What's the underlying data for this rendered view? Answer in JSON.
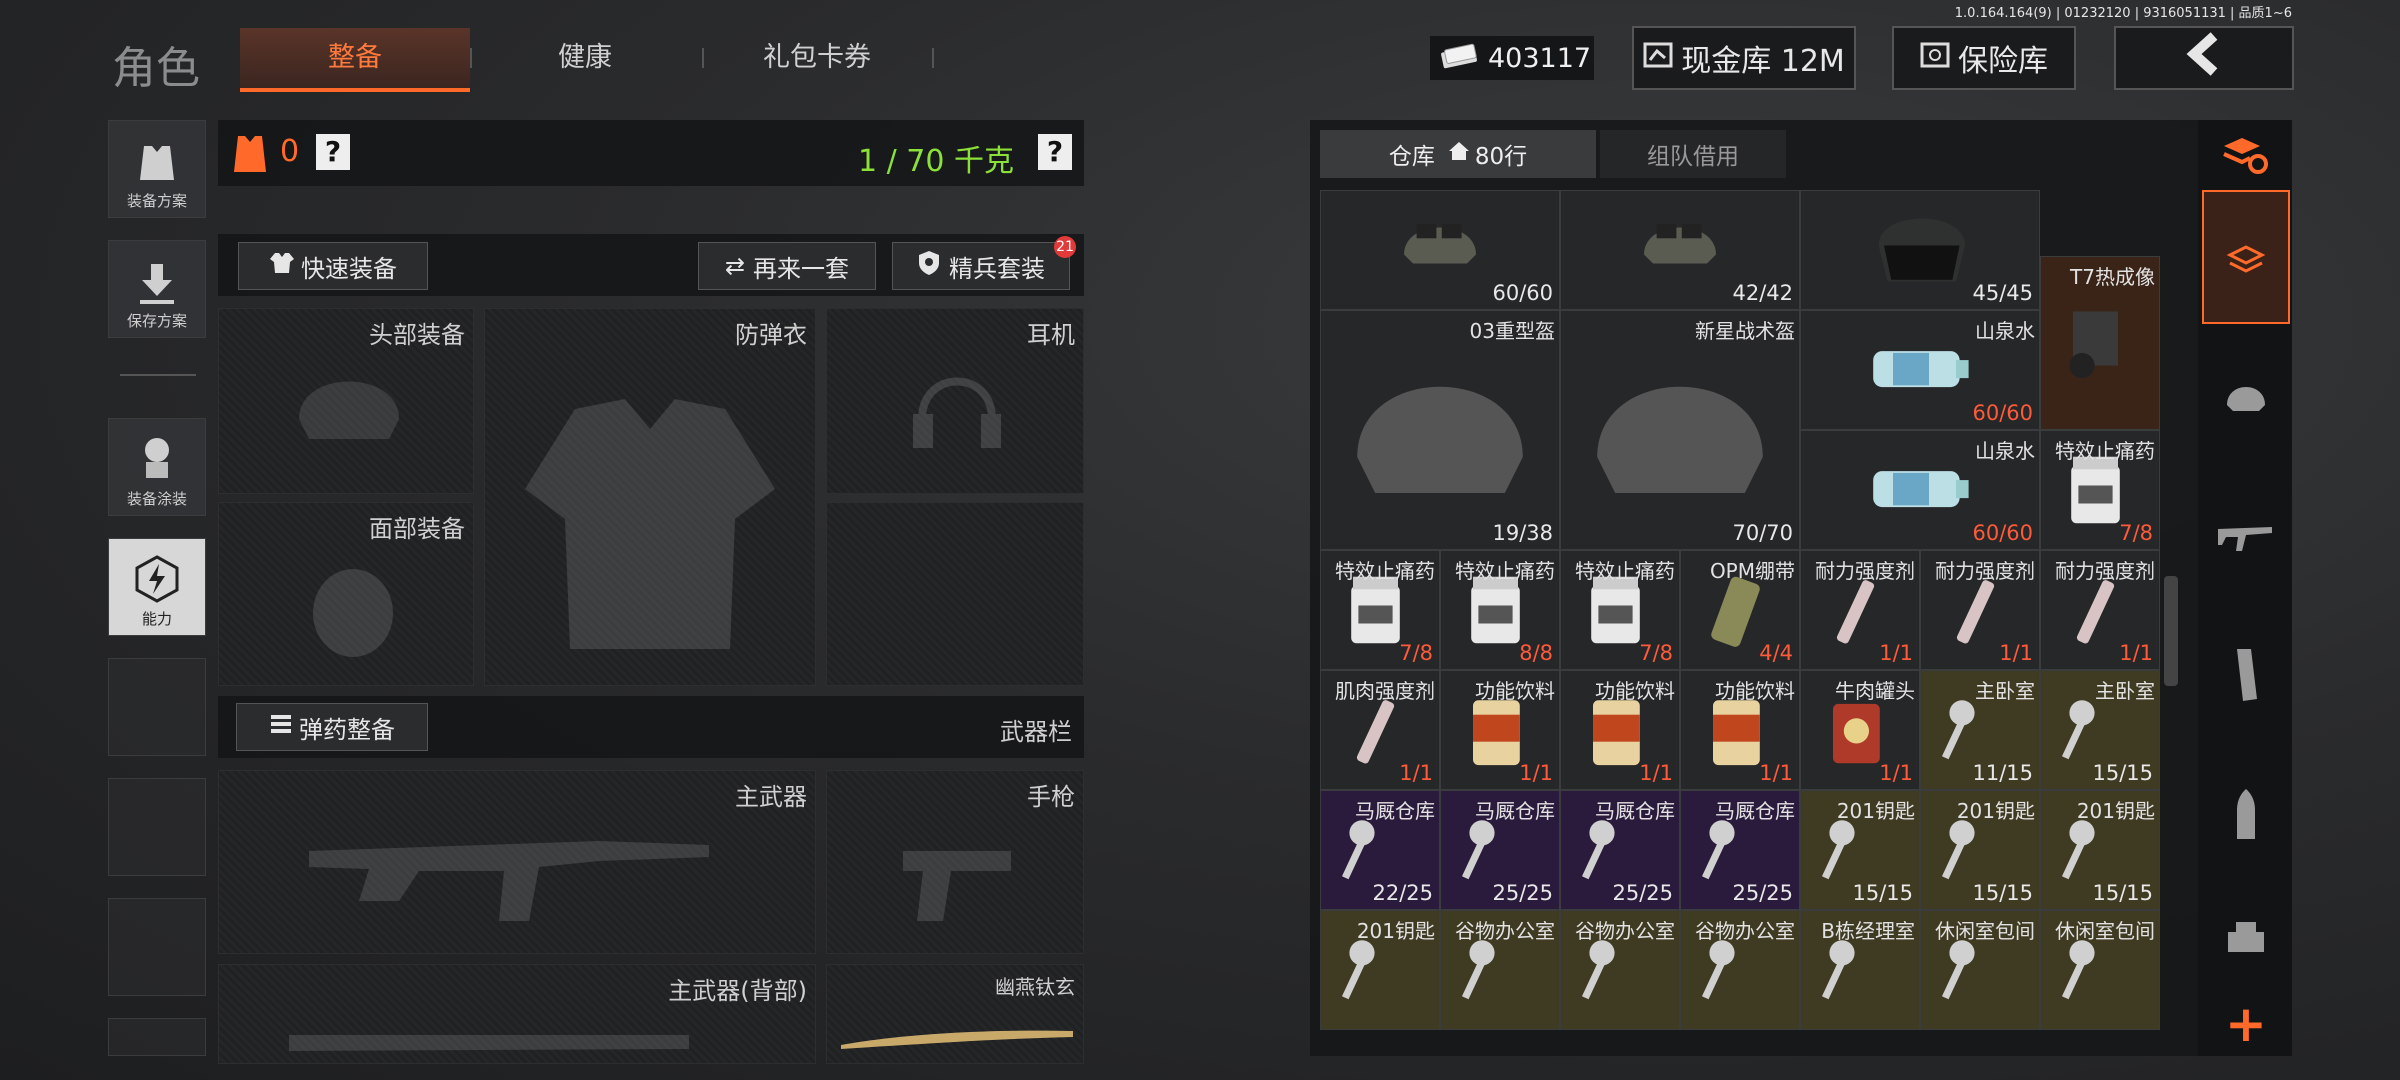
{
  "version": "1.0.164.164(9) | 01232120 | 9316051131 | 品质1~6",
  "header": {
    "title": "角色",
    "tabs": [
      {
        "label": "整备",
        "active": true
      },
      {
        "label": "健康",
        "active": false
      },
      {
        "label": "礼包卡券",
        "active": false
      }
    ],
    "currency": "403117",
    "cash_store": "现金库 12M",
    "safe": "保险库"
  },
  "sidebar": {
    "items": [
      {
        "label": "装备方案",
        "icon": "vest-plan-icon"
      },
      {
        "label": "保存方案",
        "icon": "download-icon"
      },
      {
        "label": "装备涂装",
        "icon": "paint-icon"
      },
      {
        "label": "能力",
        "icon": "ability-icon"
      }
    ]
  },
  "loadout": {
    "armor_value": "0",
    "help_1": "?",
    "weight": "1 / 70 千克",
    "help_2": "?",
    "quick_equip": "快速装备",
    "again": "再来一套",
    "elite_kit": "精兵套装",
    "elite_badge": "21",
    "slots": {
      "head": "头部装备",
      "vest": "防弹衣",
      "headset": "耳机",
      "face": "面部装备"
    },
    "ammo_equip": "弹药整备",
    "weapon_bar": "武器栏",
    "weapons": {
      "primary": "主武器",
      "pistol": "手枪",
      "primary_back": "主武器(背部)",
      "melee": "幽燕钛玄"
    }
  },
  "warehouse": {
    "tab_store": "仓库",
    "rows": "80行",
    "tab_team": "组队借用",
    "items": [
      {
        "name": "",
        "count": "60/60",
        "type": "nvg-helmet-icon",
        "col": 0,
        "row": 0,
        "w": 1,
        "h": 1
      },
      {
        "name": "",
        "count": "42/42",
        "type": "nvg-helmet-icon",
        "col": 1,
        "row": 0,
        "w": 1,
        "h": 1
      },
      {
        "name": "",
        "count": "45/45",
        "type": "faceshield-helmet-icon",
        "col": 2,
        "row": 0,
        "w": 1,
        "h": 1
      },
      {
        "name": "T7热成像",
        "count": "",
        "type": "thermal-scope-icon",
        "col": 3,
        "row": 0.55,
        "w": 0.5,
        "h": 1.45,
        "bg": "brown"
      },
      {
        "name": "03重型盔",
        "count": "19/38",
        "type": "helmet-icon",
        "col": 0,
        "row": 1,
        "w": 1,
        "h": 2
      },
      {
        "name": "新星战术盔",
        "count": "70/70",
        "type": "helmet-icon",
        "col": 1,
        "row": 1,
        "w": 1,
        "h": 2
      },
      {
        "name": "山泉水",
        "count": "60/60",
        "red": true,
        "type": "water-bottle-icon",
        "col": 2,
        "row": 1,
        "w": 1,
        "h": 1
      },
      {
        "name": "山泉水",
        "count": "60/60",
        "red": true,
        "type": "water-bottle-icon",
        "col": 2,
        "row": 2,
        "w": 1,
        "h": 1
      },
      {
        "name": "特效止痛药",
        "count": "7/8",
        "red": true,
        "type": "pill-bottle-icon",
        "col": 3,
        "row": 2,
        "w": 0.5,
        "h": 1
      },
      {
        "name": "特效止痛药",
        "count": "7/8",
        "red": true,
        "type": "pill-bottle-icon",
        "sc": 0,
        "row": 3
      },
      {
        "name": "特效止痛药",
        "count": "8/8",
        "red": true,
        "type": "pill-bottle-icon",
        "sc": 1,
        "row": 3
      },
      {
        "name": "特效止痛药",
        "count": "7/8",
        "red": true,
        "type": "pill-bottle-icon",
        "sc": 2,
        "row": 3
      },
      {
        "name": "OPM绷带",
        "count": "4/4",
        "red": true,
        "type": "bandage-icon",
        "sc": 3,
        "row": 3
      },
      {
        "name": "耐力强度剂",
        "count": "1/1",
        "red": true,
        "type": "syringe-icon",
        "sc": 4,
        "row": 3
      },
      {
        "name": "耐力强度剂",
        "count": "1/1",
        "red": true,
        "type": "syringe-icon",
        "sc": 5,
        "row": 3
      },
      {
        "name": "耐力强度剂",
        "count": "1/1",
        "red": true,
        "type": "syringe-icon",
        "sc": 6,
        "row": 3
      },
      {
        "name": "肌肉强度剂",
        "count": "1/1",
        "red": true,
        "type": "syringe-icon",
        "sc": 0,
        "row": 4
      },
      {
        "name": "功能饮料",
        "count": "1/1",
        "red": true,
        "type": "drink-can-icon",
        "sc": 1,
        "row": 4
      },
      {
        "name": "功能饮料",
        "count": "1/1",
        "red": true,
        "type": "drink-can-icon",
        "sc": 2,
        "row": 4
      },
      {
        "name": "功能饮料",
        "count": "1/1",
        "red": true,
        "type": "drink-can-icon",
        "sc": 3,
        "row": 4
      },
      {
        "name": "牛肉罐头",
        "count": "1/1",
        "red": true,
        "type": "food-can-icon",
        "sc": 4,
        "row": 4
      },
      {
        "name": "主卧室",
        "count": "11/15",
        "type": "key-icon",
        "sc": 5,
        "row": 4,
        "bg": "gold"
      },
      {
        "name": "主卧室",
        "count": "15/15",
        "type": "key-icon",
        "sc": 6,
        "row": 4,
        "bg": "gold"
      },
      {
        "name": "马厩仓库",
        "count": "22/25",
        "type": "key-icon",
        "sc": 0,
        "row": 5,
        "bg": "purple"
      },
      {
        "name": "马厩仓库",
        "count": "25/25",
        "type": "key-icon",
        "sc": 1,
        "row": 5,
        "bg": "purple"
      },
      {
        "name": "马厩仓库",
        "count": "25/25",
        "type": "key-icon",
        "sc": 2,
        "row": 5,
        "bg": "purple"
      },
      {
        "name": "马厩仓库",
        "count": "25/25",
        "type": "key-icon",
        "sc": 3,
        "row": 5,
        "bg": "purple"
      },
      {
        "name": "201钥匙",
        "count": "15/15",
        "type": "key-icon",
        "sc": 4,
        "row": 5,
        "bg": "gold"
      },
      {
        "name": "201钥匙",
        "count": "15/15",
        "type": "key-icon",
        "sc": 5,
        "row": 5,
        "bg": "gold"
      },
      {
        "name": "201钥匙",
        "count": "15/15",
        "type": "key-icon",
        "sc": 6,
        "row": 5,
        "bg": "gold"
      },
      {
        "name": "201钥匙",
        "count": "",
        "type": "key-icon",
        "sc": 0,
        "row": 6,
        "bg": "gold"
      },
      {
        "name": "谷物办公室",
        "count": "",
        "type": "key-icon",
        "sc": 1,
        "row": 6,
        "bg": "gold"
      },
      {
        "name": "谷物办公室",
        "count": "",
        "type": "key-icon",
        "sc": 2,
        "row": 6,
        "bg": "gold"
      },
      {
        "name": "谷物办公室",
        "count": "",
        "type": "key-icon",
        "sc": 3,
        "row": 6,
        "bg": "gold"
      },
      {
        "name": "B栋经理室",
        "count": "",
        "type": "key-icon",
        "sc": 4,
        "row": 6,
        "bg": "gold"
      },
      {
        "name": "休闲室包间",
        "count": "",
        "type": "key-icon",
        "sc": 5,
        "row": 6,
        "bg": "gold"
      },
      {
        "name": "休闲室包间",
        "count": "",
        "type": "key-icon",
        "sc": 6,
        "row": 6,
        "bg": "gold"
      }
    ]
  },
  "right_tools": [
    "sort-icon",
    "stash-icon",
    "helmet-icon",
    "rifle-icon",
    "magazine-icon",
    "ammo-icon",
    "scope-icon"
  ],
  "add_label": "+",
  "colors": {
    "accent": "#ff6a2a",
    "weight_green": "#8be03a",
    "count_red": "#ff5a3a"
  }
}
